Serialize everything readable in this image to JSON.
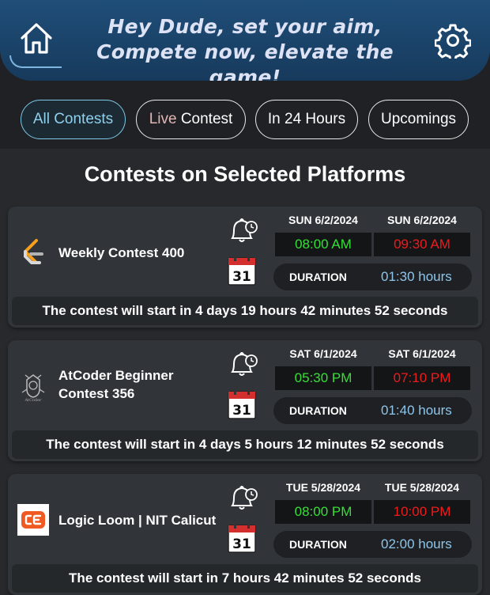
{
  "header": {
    "title_line1": "Hey Dude, set your aim,",
    "title_line2": "Compete now, elevate the game!",
    "home_icon": "home-icon",
    "settings_icon": "gear-icon"
  },
  "filters": {
    "all": "All Contests",
    "live_prefix": "Live",
    "live_suffix": "Contest",
    "day": "In 24 Hours",
    "upcoming": "Upcomings",
    "active": "all"
  },
  "section": {
    "title": "Contests on Selected Platforms"
  },
  "contests": [
    {
      "name": "Weekly Contest 400",
      "platform_icon": "leetcode-logo",
      "start_date": "SUN 6/2/2024",
      "end_date": "SUN 6/2/2024",
      "start_time": "08:00 AM",
      "end_time": "09:30 AM",
      "duration_label": "DURATION",
      "duration": "01:30 hours",
      "countdown": "The contest will start in 4 days 19 hours 42 minutes 52 seconds"
    },
    {
      "name": "AtCoder Beginner Contest 356",
      "platform_icon": "atcoder-logo",
      "start_date": "SAT 6/1/2024",
      "end_date": "SAT 6/1/2024",
      "start_time": "05:30 PM",
      "end_time": "07:10 PM",
      "duration_label": "DURATION",
      "duration": "01:40 hours",
      "countdown": "The contest will start in 4 days 5 hours 12 minutes 52 seconds"
    },
    {
      "name": "Logic Loom | NIT Calicut",
      "platform_icon": "codechef-logo",
      "start_date": "TUE 5/28/2024",
      "end_date": "TUE 5/28/2024",
      "start_time": "08:00 PM",
      "end_time": "10:00 PM",
      "duration_label": "DURATION",
      "duration": "02:00 hours",
      "countdown": "The contest will start in 7 hours 42 minutes 52 seconds"
    }
  ],
  "calendar_day": "31",
  "colors": {
    "start_time": "#35e035",
    "end_time": "#ee1b1b",
    "duration": "#8ec6ec",
    "active_pill": "#7ec8e8"
  }
}
